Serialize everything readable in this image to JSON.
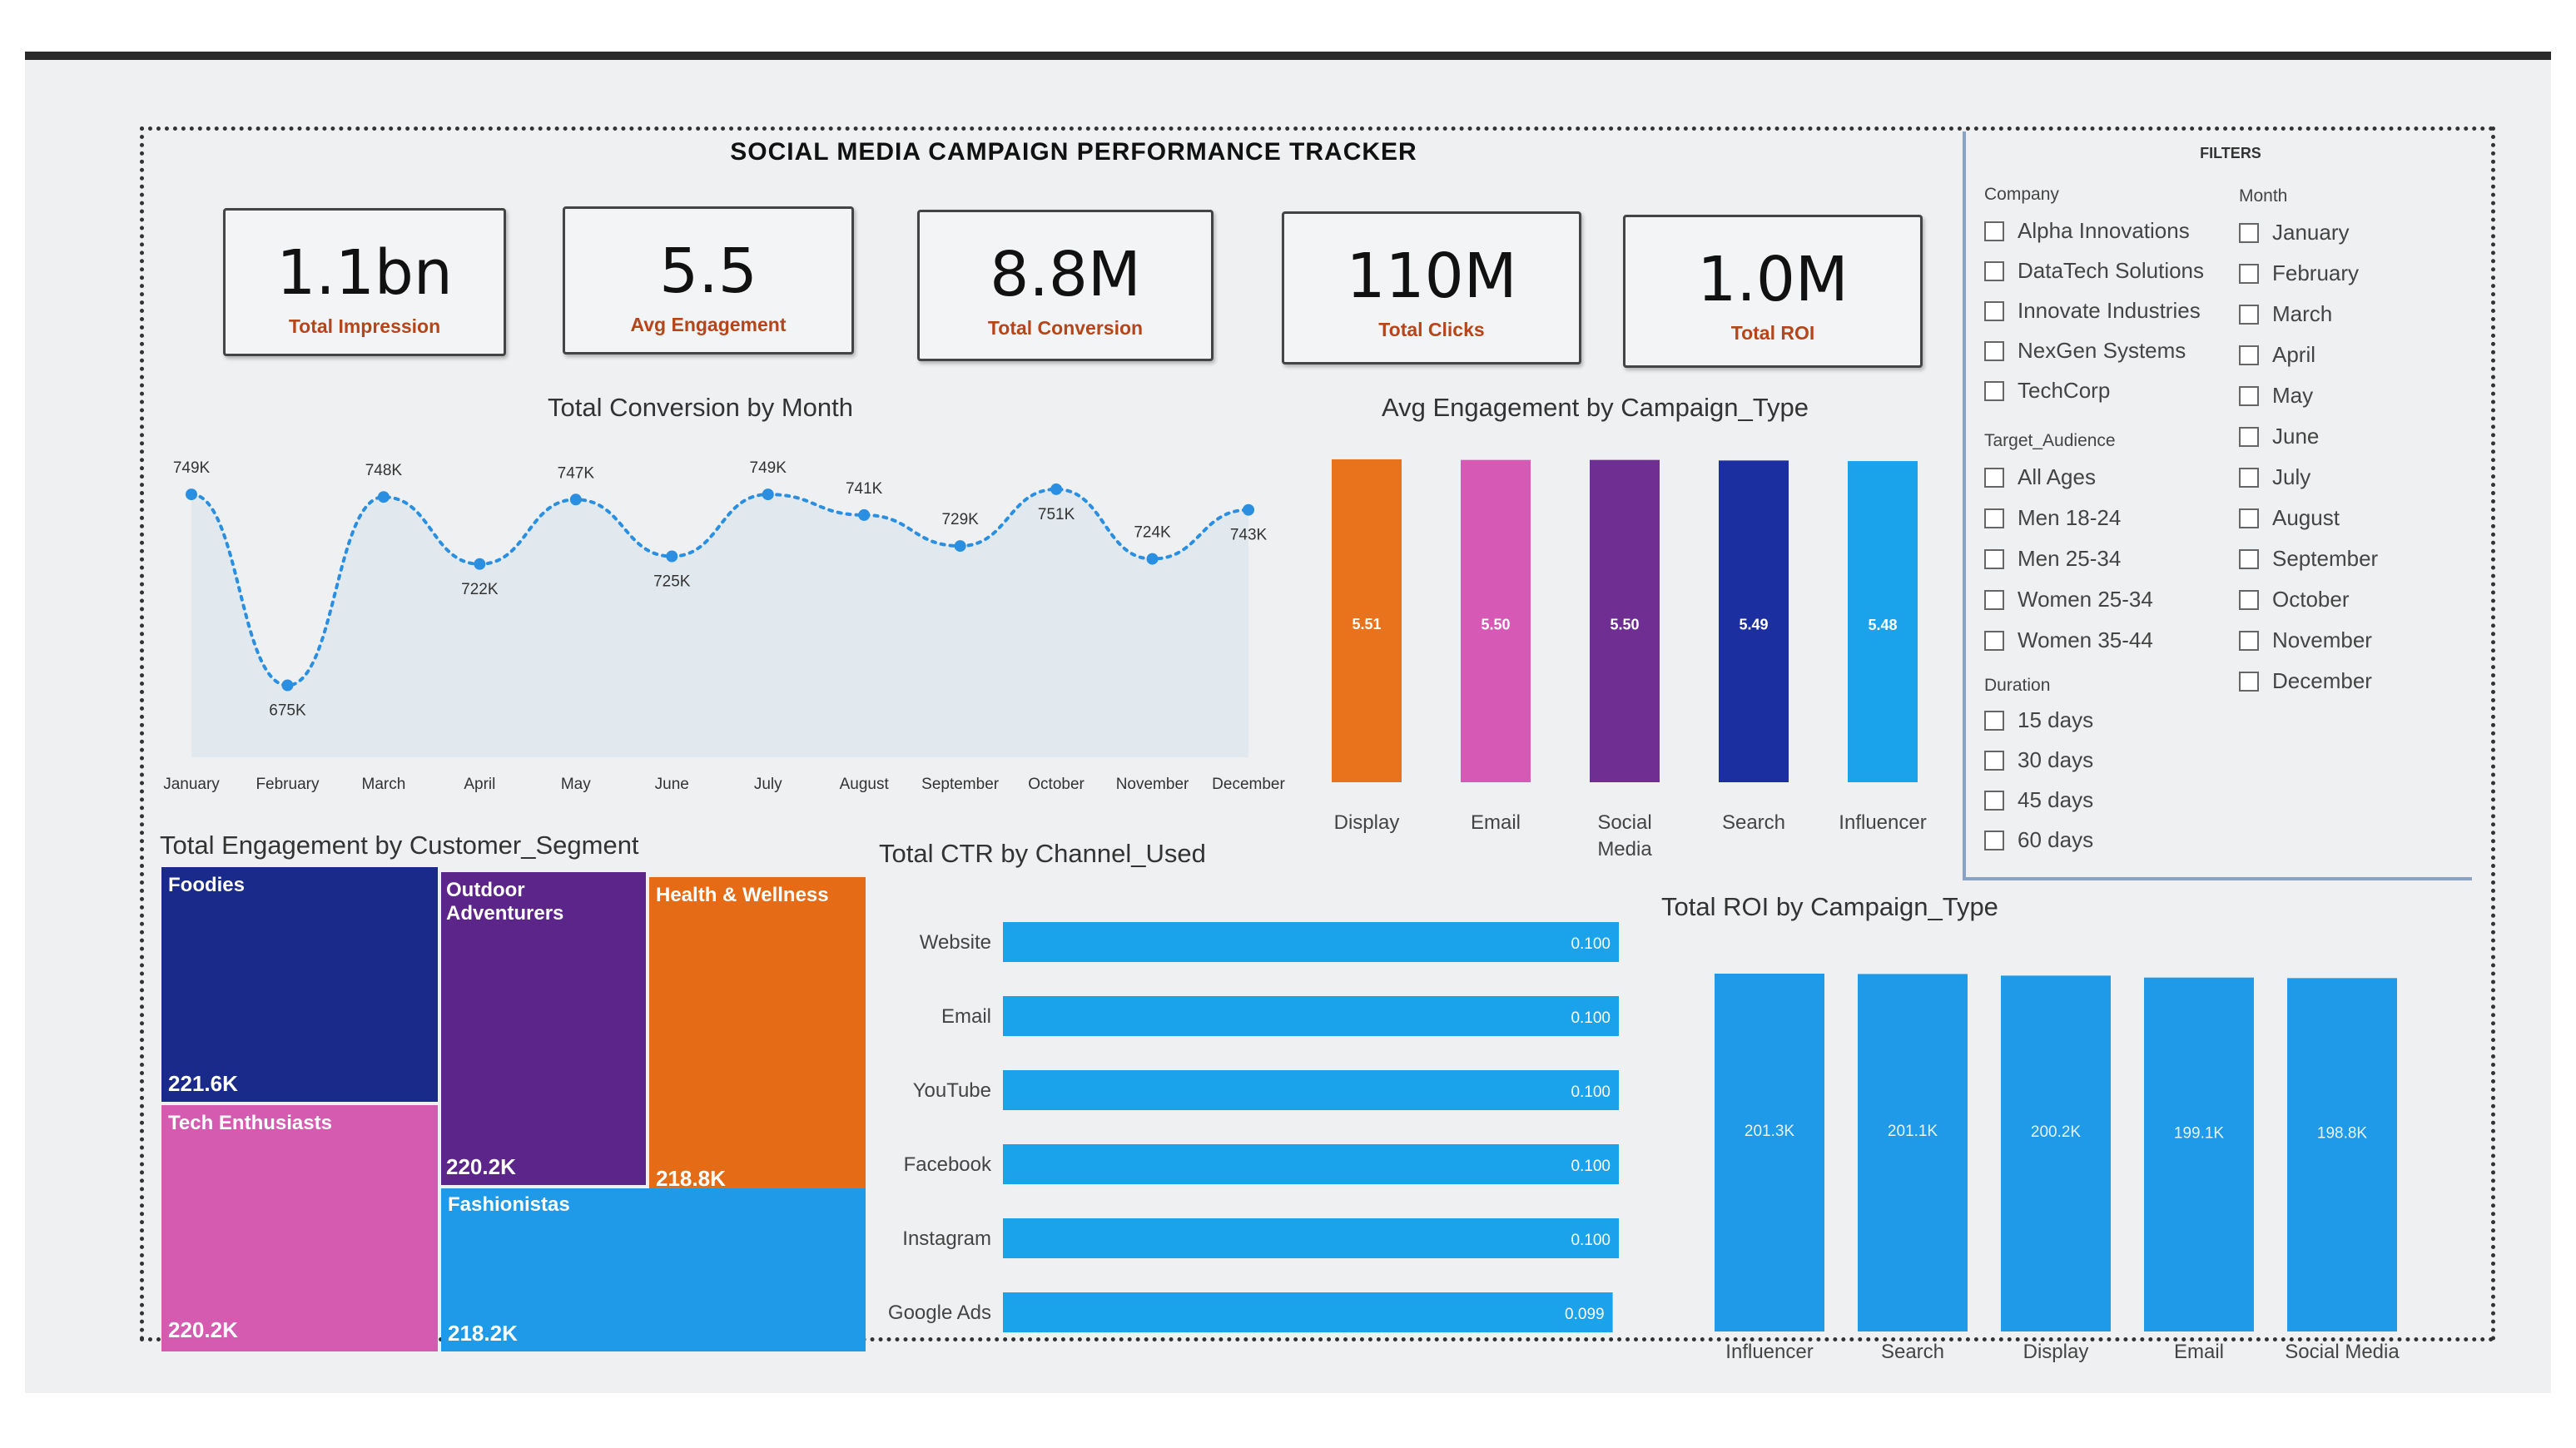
{
  "dashboard_title": "SOCIAL MEDIA CAMPAIGN PERFORMANCE TRACKER",
  "kpis": [
    {
      "value": "1.1bn",
      "label": "Total Impression"
    },
    {
      "value": "5.5",
      "label": "Avg Engagement"
    },
    {
      "value": "8.8M",
      "label": "Total Conversion"
    },
    {
      "value": "110M",
      "label": "Total Clicks"
    },
    {
      "value": "1.0M",
      "label": "Total ROI"
    }
  ],
  "filters": {
    "title": "FILTERS",
    "company": {
      "label": "Company",
      "items": [
        "Alpha Innovations",
        "DataTech Solutions",
        "Innovate Industries",
        "NexGen Systems",
        "TechCorp"
      ]
    },
    "target_audience": {
      "label": "Target_Audience",
      "items": [
        "All Ages",
        "Men 18-24",
        "Men 25-34",
        "Women 25-34",
        "Women 35-44"
      ]
    },
    "duration": {
      "label": "Duration",
      "items": [
        "15 days",
        "30 days",
        "45 days",
        "60 days"
      ]
    },
    "month": {
      "label": "Month",
      "items": [
        "January",
        "February",
        "March",
        "April",
        "May",
        "June",
        "July",
        "August",
        "September",
        "October",
        "November",
        "December"
      ]
    }
  },
  "chart_data": [
    {
      "id": "conversion_by_month",
      "type": "line",
      "title": "Total Conversion by Month",
      "categories": [
        "January",
        "February",
        "March",
        "April",
        "May",
        "June",
        "July",
        "August",
        "September",
        "October",
        "November",
        "December"
      ],
      "values": [
        749,
        675,
        748,
        722,
        747,
        725,
        749,
        741,
        729,
        751,
        724,
        743
      ],
      "value_labels": [
        "749K",
        "675K",
        "748K",
        "722K",
        "747K",
        "725K",
        "749K",
        "741K",
        "729K",
        "751K",
        "724K",
        "743K"
      ],
      "unit": "K",
      "ylim": [
        660,
        760
      ],
      "color": "#2a8fe0"
    },
    {
      "id": "engagement_by_campaign",
      "type": "bar",
      "title": "Avg Engagement by Campaign_Type",
      "categories": [
        "Display",
        "Email",
        "Social Media",
        "Search",
        "Influencer"
      ],
      "values": [
        5.51,
        5.5,
        5.5,
        5.49,
        5.48
      ],
      "value_labels": [
        "5.51",
        "5.50",
        "5.50",
        "5.49",
        "5.48"
      ],
      "colors": [
        "#e8731c",
        "#d659b6",
        "#6f2e91",
        "#1b2fa0",
        "#1aa3eb"
      ]
    },
    {
      "id": "engagement_by_segment",
      "type": "treemap",
      "title": "Total Engagement by Customer_Segment",
      "segments": [
        {
          "name": "Foodies",
          "value": 221.6,
          "label": "221.6K",
          "color": "#1a2a8a"
        },
        {
          "name": "Tech Enthusiasts",
          "value": 220.2,
          "label": "220.2K",
          "color": "#d45bb0"
        },
        {
          "name": "Outdoor Adventurers",
          "value": 220.2,
          "label": "220.2K",
          "color": "#5c2589"
        },
        {
          "name": "Health & Wellness",
          "value": 218.8,
          "label": "218.8K",
          "color": "#e66b16"
        },
        {
          "name": "Fashionistas",
          "value": 218.2,
          "label": "218.2K",
          "color": "#1e9ae8"
        }
      ]
    },
    {
      "id": "ctr_by_channel",
      "type": "bar",
      "orientation": "horizontal",
      "title": "Total CTR by Channel_Used",
      "categories": [
        "Website",
        "Email",
        "YouTube",
        "Facebook",
        "Instagram",
        "Google Ads"
      ],
      "values": [
        0.1,
        0.1,
        0.1,
        0.1,
        0.1,
        0.099
      ],
      "value_labels": [
        "0.100",
        "0.100",
        "0.100",
        "0.100",
        "0.100",
        "0.099"
      ],
      "color": "#1aa3eb"
    },
    {
      "id": "roi_by_campaign",
      "type": "bar",
      "title": "Total ROI by Campaign_Type",
      "categories": [
        "Influencer",
        "Search",
        "Display",
        "Email",
        "Social Media"
      ],
      "values": [
        201.3,
        201.1,
        200.2,
        199.1,
        198.8
      ],
      "value_labels": [
        "201.3K",
        "201.1K",
        "200.2K",
        "199.1K",
        "198.8K"
      ],
      "color": "#1e9ae8"
    }
  ]
}
